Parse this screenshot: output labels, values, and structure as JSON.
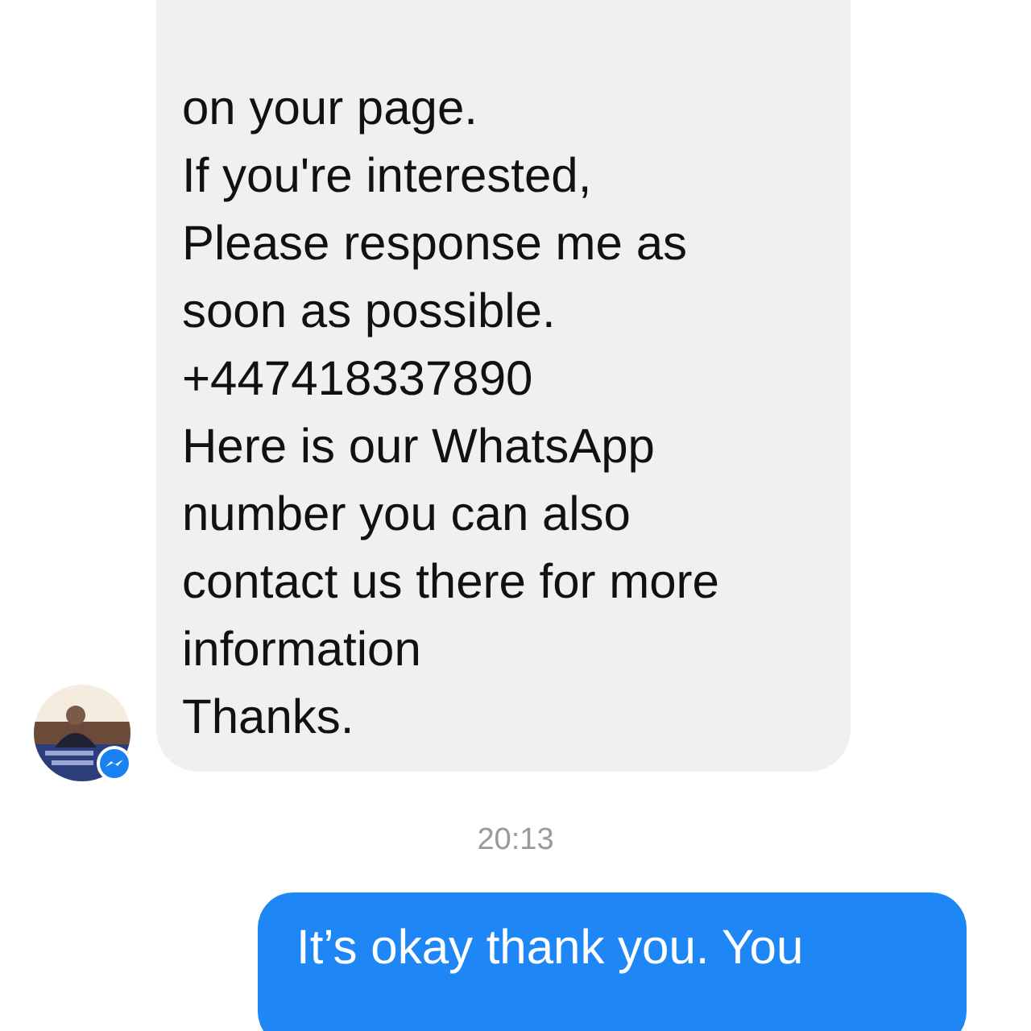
{
  "messages": [
    {
      "kind": "received",
      "lines": [
        "on your page.",
        "If you're interested,",
        "Please response me as",
        "soon as possible.",
        "+447418337890",
        "Here is our WhatsApp",
        "number you can also",
        "contact us there for more",
        "information",
        "Thanks."
      ]
    },
    {
      "kind": "timestamp",
      "text": "20:13"
    },
    {
      "kind": "sent",
      "lines": [
        "It’s okay thank you. You"
      ]
    }
  ]
}
